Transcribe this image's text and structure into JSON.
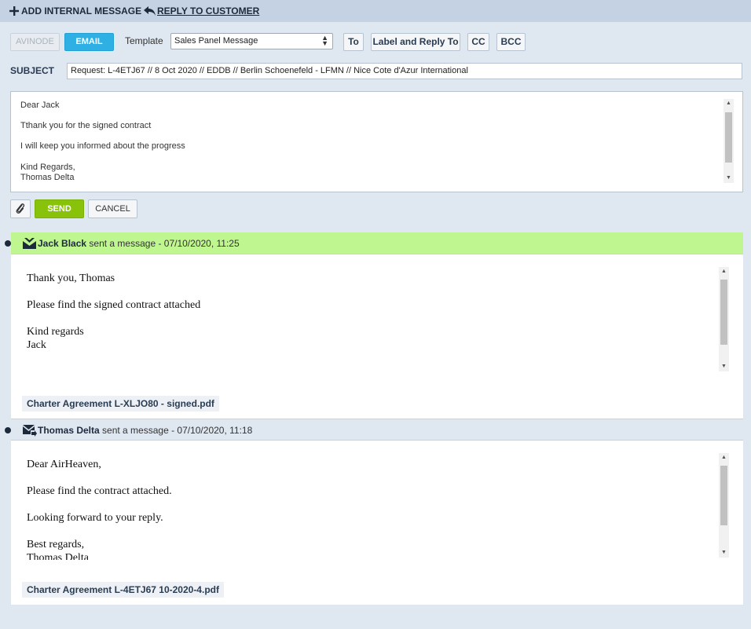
{
  "topbar": {
    "add_internal_message": "ADD INTERNAL MESSAGE",
    "reply_to_customer": "REPLY TO CUSTOMER"
  },
  "compose": {
    "avinode_label": "AVINODE",
    "email_label": "EMAIL",
    "template_label": "Template",
    "template_value": "Sales Panel Message",
    "to_label": "To",
    "label_reply_label": "Label and Reply To",
    "cc_label": "CC",
    "bcc_label": "BCC",
    "subject_label": "SUBJECT",
    "subject_value": "Request: L-4ETJ67 // 8 Oct 2020 // EDDB // Berlin Schoenefeld - LFMN // Nice Cote d'Azur International",
    "body_lines": [
      "Dear Jack",
      "Tthank you for the signed contract",
      "I will keep you informed about the progress",
      "Kind Regards,",
      "Thomas Delta"
    ],
    "send_label": "SEND",
    "cancel_label": "CANCEL"
  },
  "messages": [
    {
      "sender": "Jack Black",
      "meta": " sent a message - 07/10/2020, 11:25",
      "header_color": "#bff68f",
      "icon": "envelope-incoming-icon",
      "body_lines": [
        "Thank you, Thomas",
        "Please find the signed contract attached",
        "Kind regards",
        "Jack"
      ],
      "attachment": "Charter Agreement L-XLJO80 - signed.pdf"
    },
    {
      "sender": "Thomas Delta",
      "meta": " sent a message - 07/10/2020, 11:18",
      "header_color": "#dfe7f1",
      "icon": "envelope-outgoing-icon",
      "body_lines": [
        "Dear AirHeaven,",
        "Please find the contract attached.",
        "Looking forward to your reply.",
        "Best regards,",
        "Thomas Delta"
      ],
      "attachment": "Charter Agreement L-4ETJ67 10-2020-4.pdf"
    }
  ]
}
